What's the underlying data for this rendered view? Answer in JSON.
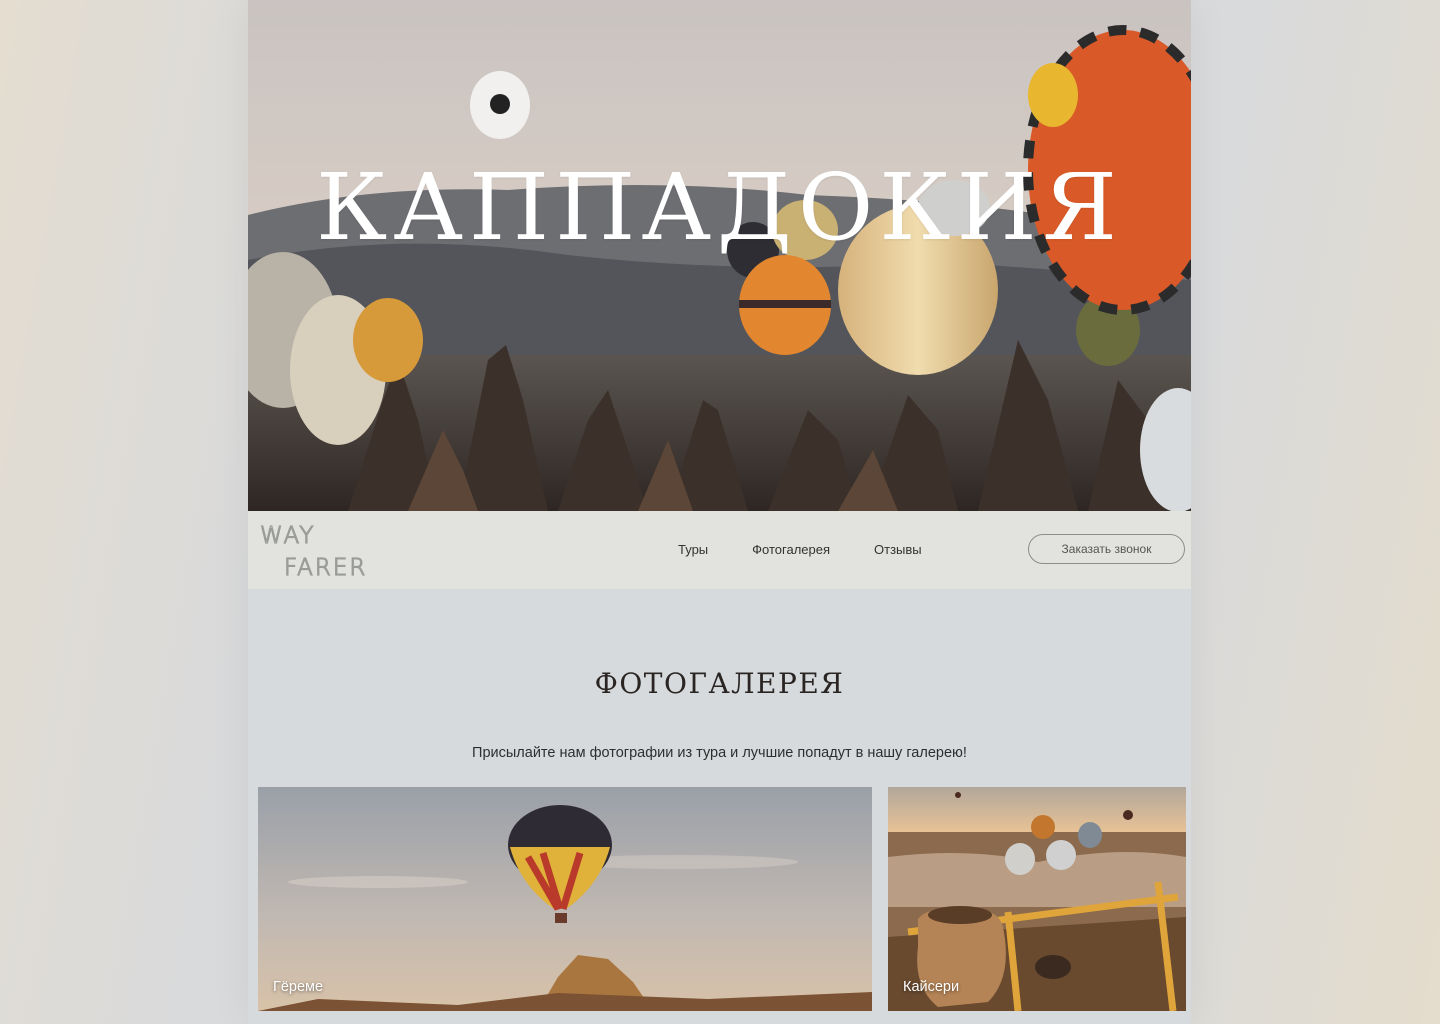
{
  "hero": {
    "title": "КАППАДОКИЯ",
    "image": "cappadocia-hot-air-balloons-photo"
  },
  "nav": {
    "logo_line1": "WAY",
    "logo_line2": "FARER",
    "menu": [
      {
        "label": "Туры"
      },
      {
        "label": "Фотогалерея"
      },
      {
        "label": "Отзывы"
      }
    ],
    "cta_label": "Заказать звонок"
  },
  "gallery": {
    "title": "ФОТОГАЛЕРЕЯ",
    "subtitle": "Присылайте нам фотографии из тура и лучшие попадут в нашу галерею!",
    "cards": [
      {
        "caption": "Гёреме",
        "image": "goreme-balloon-photo"
      },
      {
        "caption": "Кайсери",
        "image": "kayseri-valley-photo"
      }
    ]
  },
  "colors": {
    "page_bg": "#d6dadd",
    "nav_bg": "#e2e3df",
    "title_text": "#2a2523"
  }
}
